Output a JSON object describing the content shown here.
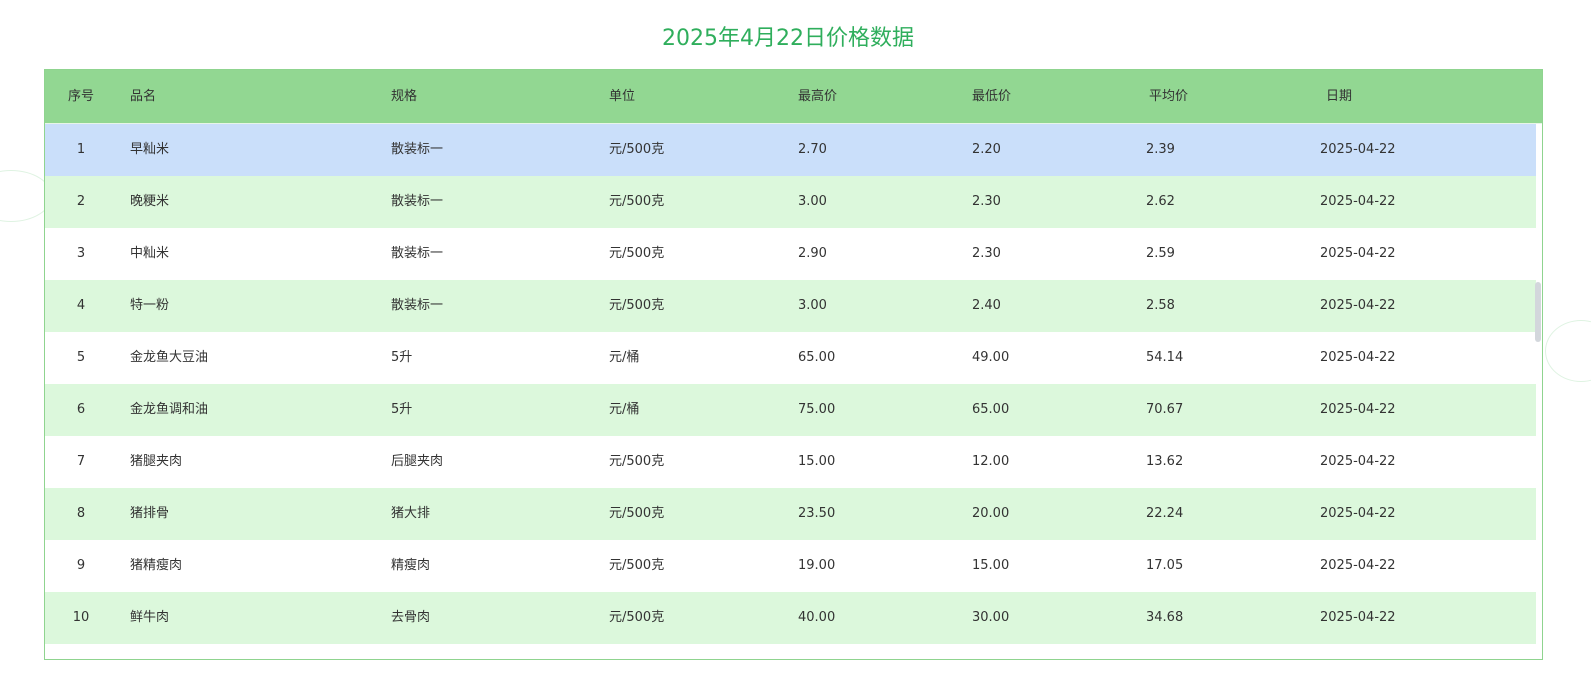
{
  "title": "2025年4月22日价格数据",
  "columns": [
    "序号",
    "品名",
    "规格",
    "单位",
    "最高价",
    "最低价",
    "平均价",
    "日期"
  ],
  "rows": [
    [
      "1",
      "早籼米",
      "散装标一",
      "元/500克",
      "2.70",
      "2.20",
      "2.39",
      "2025-04-22"
    ],
    [
      "2",
      "晚粳米",
      "散装标一",
      "元/500克",
      "3.00",
      "2.30",
      "2.62",
      "2025-04-22"
    ],
    [
      "3",
      "中籼米",
      "散装标一",
      "元/500克",
      "2.90",
      "2.30",
      "2.59",
      "2025-04-22"
    ],
    [
      "4",
      "特一粉",
      "散装标一",
      "元/500克",
      "3.00",
      "2.40",
      "2.58",
      "2025-04-22"
    ],
    [
      "5",
      "金龙鱼大豆油",
      "5升",
      "元/桶",
      "65.00",
      "49.00",
      "54.14",
      "2025-04-22"
    ],
    [
      "6",
      "金龙鱼调和油",
      "5升",
      "元/桶",
      "75.00",
      "65.00",
      "70.67",
      "2025-04-22"
    ],
    [
      "7",
      "猪腿夹肉",
      "后腿夹肉",
      "元/500克",
      "15.00",
      "12.00",
      "13.62",
      "2025-04-22"
    ],
    [
      "8",
      "猪排骨",
      "猪大排",
      "元/500克",
      "23.50",
      "20.00",
      "22.24",
      "2025-04-22"
    ],
    [
      "9",
      "猪精瘦肉",
      "精瘦肉",
      "元/500克",
      "19.00",
      "15.00",
      "17.05",
      "2025-04-22"
    ],
    [
      "10",
      "鲜牛肉",
      "去骨肉",
      "元/500克",
      "40.00",
      "30.00",
      "34.68",
      "2025-04-22"
    ]
  ],
  "colors": {
    "header": "#92d792",
    "stripe": "#dcf8dc",
    "selected": "#cadffa",
    "title": "#2fae5c"
  }
}
